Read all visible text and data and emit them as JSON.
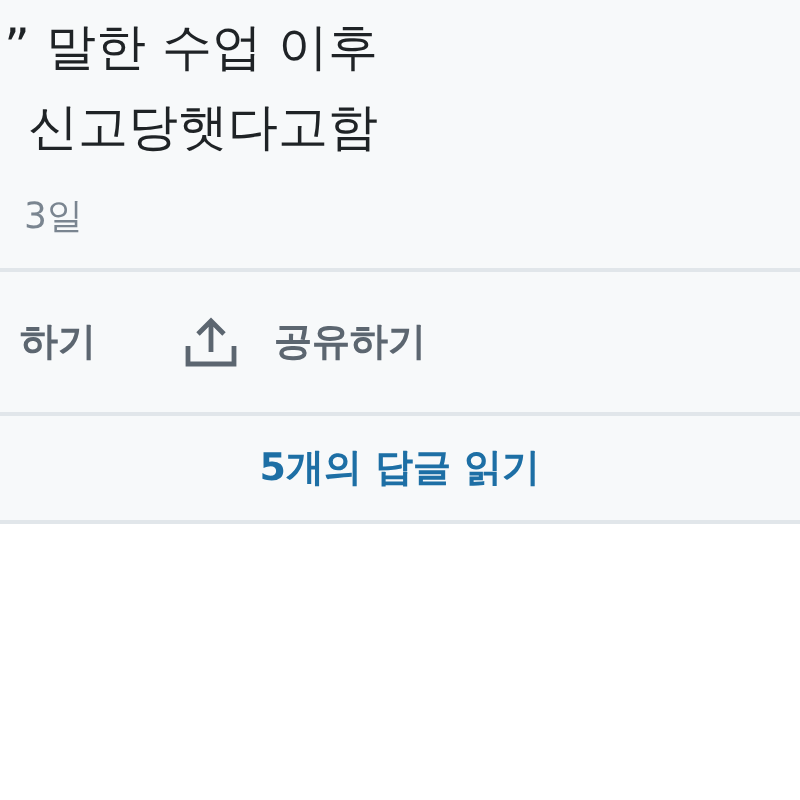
{
  "tweet": {
    "text_lines": [
      "” 말한 수업 이후",
      "신고당햇다고함"
    ],
    "date": "3일"
  },
  "actions": [
    {
      "kind": "reply",
      "label": "하기"
    },
    {
      "kind": "share",
      "label": "공유하기"
    }
  ],
  "replies_link": "5개의 답글 읽기"
}
